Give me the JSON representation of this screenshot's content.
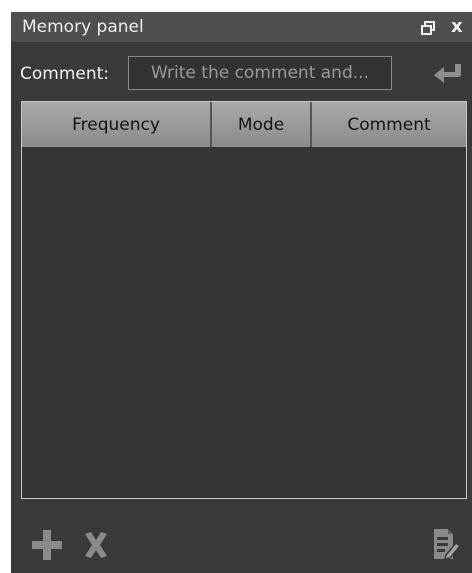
{
  "window": {
    "title": "Memory panel",
    "restore_icon": "restore-window-icon",
    "close_label": "x"
  },
  "comment": {
    "label": "Comment:",
    "placeholder": "Write the comment and...",
    "enter_icon": "enter-return-icon"
  },
  "table": {
    "columns": [
      "Frequency",
      "Mode",
      "Comment"
    ],
    "rows": []
  },
  "footer": {
    "add_icon": "plus-icon",
    "delete_icon": "x-delete-icon",
    "edit_icon": "edit-document-icon"
  },
  "colors": {
    "panel_bg": "#3a3a3a",
    "titlebar_bg": "#4f4f4f",
    "header_bg": "#9a9a9a",
    "icon_gray": "#8a8a8a"
  }
}
